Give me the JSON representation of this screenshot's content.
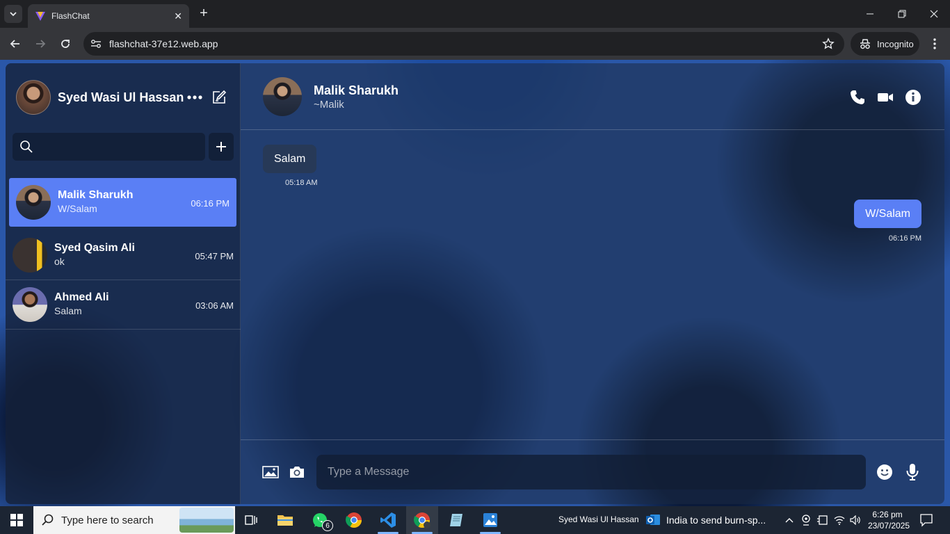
{
  "browser": {
    "tab_title": "FlashChat",
    "url": "flashchat-37e12.web.app",
    "profile_label": "Incognito"
  },
  "app": {
    "current_user": "Syed Wasi Ul Hassan",
    "search_placeholder": "",
    "chats": [
      {
        "name": "Malik Sharukh",
        "last_message": "W/Salam",
        "time": "06:16 PM",
        "active": true
      },
      {
        "name": "Syed Qasim Ali",
        "last_message": "ok",
        "time": "05:47 PM",
        "active": false
      },
      {
        "name": "Ahmed Ali",
        "last_message": "Salam",
        "time": "03:06 AM",
        "active": false
      }
    ],
    "conversation": {
      "peer_name": "Malik Sharukh",
      "peer_handle": "~Malik",
      "messages": [
        {
          "direction": "incoming",
          "text": "Salam",
          "time": "05:18 AM"
        },
        {
          "direction": "outgoing",
          "text": "W/Salam",
          "time": "06:16 PM"
        }
      ],
      "composer_placeholder": "Type a Message"
    },
    "accent_color": "#5a7ff5"
  },
  "taskbar": {
    "search_placeholder": "Type here to search",
    "whatsapp_badge": "6",
    "user_label": "Syed Wasi Ul Hassan",
    "news_text": "India to send burn-sp...",
    "clock_time": "6:26 pm",
    "clock_date": "23/07/2025"
  }
}
